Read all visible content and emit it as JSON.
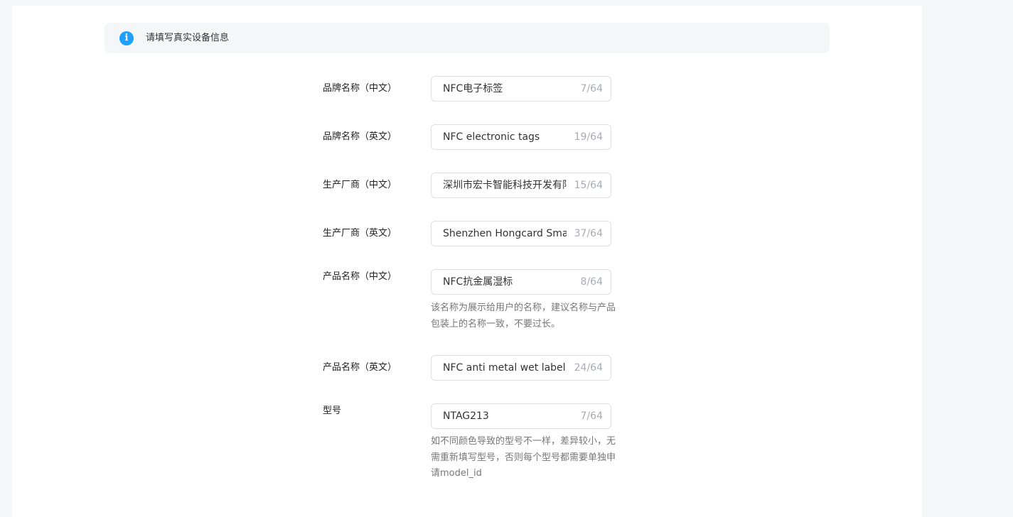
{
  "notice": {
    "icon": "info-icon",
    "icon_glyph": "i",
    "text": "请填写真实设备信息",
    "icon_color": "#1ea0ff"
  },
  "fields": [
    {
      "label": "品牌名称（中文）",
      "value": "NFC电子标签",
      "count": "7/64"
    },
    {
      "label": "品牌名称（英文）",
      "value": "NFC electronic tags",
      "count": "19/64"
    },
    {
      "label": "生产厂商（中文）",
      "value": "深圳市宏卡智能科技开发有限",
      "count": "15/64"
    },
    {
      "label": "生产厂商（英文）",
      "value": "Shenzhen Hongcard Smart",
      "count": "37/64"
    },
    {
      "label": "产品名称（中文）",
      "value": "NFC抗金属湿标",
      "count": "8/64",
      "hint": "该名称为展示给用户的名称，建议名称与产品包装上的名称一致，不要过长。"
    },
    {
      "label": "产品名称（英文）",
      "value": "NFC anti metal wet label",
      "count": "24/64"
    },
    {
      "label": "型号",
      "value": "NTAG213",
      "count": "7/64",
      "hint": "如不同颜色导致的型号不一样，差异较小，无需重新填写型号，否则每个型号都需要单独申请model_id"
    }
  ]
}
